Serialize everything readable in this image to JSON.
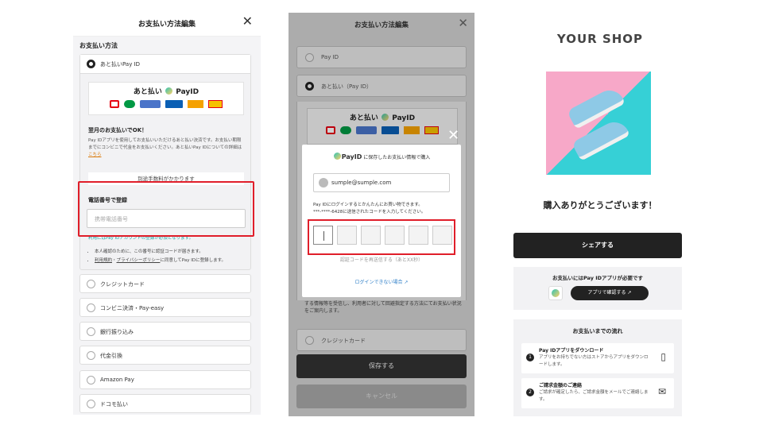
{
  "panel1": {
    "title": "お支払い方法編集",
    "section_label": "お支払い方法",
    "selected_option": "あと払いPay ID",
    "logo_text": "あと払い",
    "logo_brand": "PayID",
    "promo_title": "翌月のお支払いでOK！",
    "promo_desc": "Pay IDアプリを使用してお支払いいただけるあと払い決済です。お支払い期限までにコンビニで代金をお支払いください。あと払いPay IDについての詳細は",
    "promo_link": "こちら",
    "fee_label": "別途手数料がかかります",
    "phone_title": "電話番号で登録",
    "phone_placeholder": "携帯電話番号",
    "phone_note": "利用にはPay IDアカウントの登録が必須となります。",
    "bullet1": "本人確認のために、この番号に認証コードが届きます。",
    "bullet2_link1": "利用規約",
    "bullet2_sep": "・",
    "bullet2_link2": "プライバシーポリシー",
    "bullet2_rest": "に同意してPay IDに登録します。",
    "options": [
      "クレジットカード",
      "コンビニ決済・Pay-easy",
      "銀行振り込み",
      "代金引換",
      "Amazon Pay",
      "ドコモ払い"
    ]
  },
  "panel2": {
    "title": "お支払い方法編集",
    "opt_payid": "Pay ID",
    "opt_atobarai": "あと払い（Pay ID）",
    "modal_brand": "PayID",
    "modal_head": "に保存したお支払い情報で購入",
    "email": "sumple@sumple.com",
    "msg1": "Pay IDにログインするとかんたんにお買い物できます。",
    "msg2": "***-****-6428に送信されたコードを入力してください。",
    "resend": "認証コードを再送信する（あとXX秒）",
    "login_help": "ログインできない場合",
    "after_text": "する情報等を受信し、利用者に対して回避指定する方法にてお支払い状況をご案内します。",
    "opt_credit": "クレジットカード",
    "save": "保存する",
    "cancel": "キャンセル"
  },
  "panel3": {
    "shop": "YOUR SHOP",
    "thanks": "購入ありがとうございます！",
    "share": "シェアする",
    "need_app": "お支払いにはPay IDアプリが必要です",
    "check_app": "アプリで確認する",
    "flow_title": "お支払いまでの流れ",
    "step1_title": "Pay IDアプリをダウンロード",
    "step1_desc": "アプリをお持ちでない方はストアからアプリをダウンロードします。",
    "step2_title": "ご請求金額のご連絡",
    "step2_desc": "ご請求が確定したら、ご請求金額をメールでご連絡します。"
  },
  "icons": {
    "close": "close-icon",
    "avatar": "user-icon",
    "external": "external-link-icon",
    "phone": "phone-icon",
    "mail": "mail-icon"
  },
  "colors": {
    "highlight": "#e01e2a",
    "accent_link": "#d97706",
    "note_teal": "#16a3a3",
    "dark_button": "#222222"
  }
}
